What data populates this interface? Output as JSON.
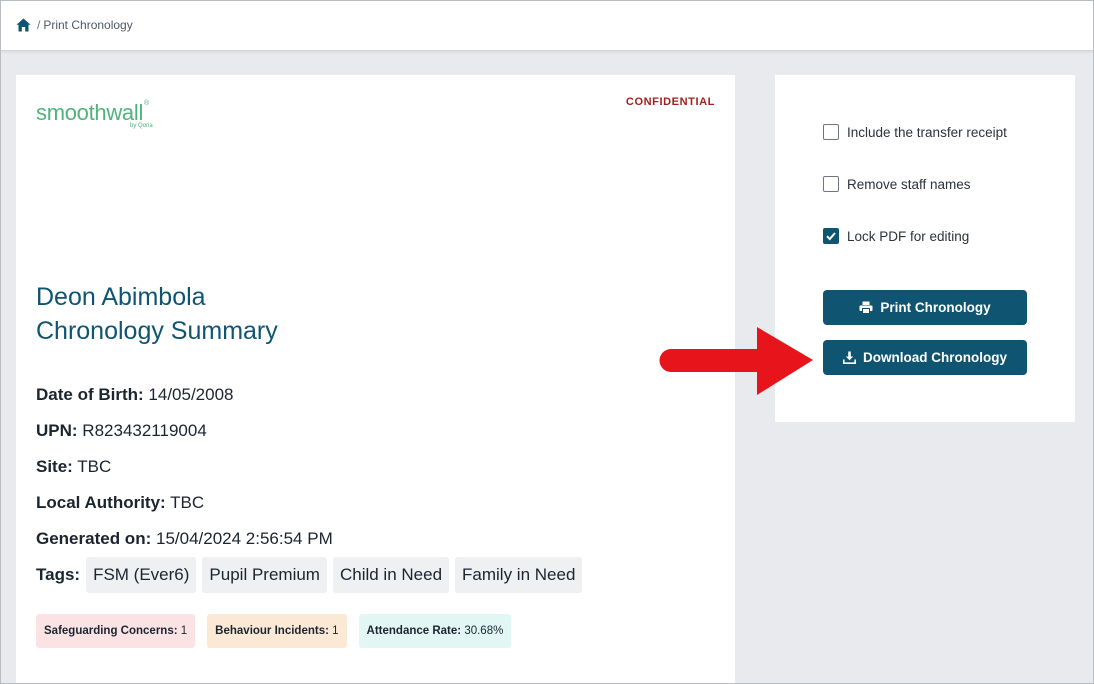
{
  "breadcrumb": {
    "home_icon": "home-icon",
    "separator": "/",
    "current": "Print Chronology"
  },
  "document": {
    "logo": {
      "text": "smoothwall",
      "sub": "by Qoria"
    },
    "confidential": "CONFIDENTIAL",
    "title_line1": "Deon Abimbola",
    "title_line2": "Chronology Summary",
    "fields": [
      {
        "label": "Date of Birth:",
        "value": "14/05/2008"
      },
      {
        "label": "UPN:",
        "value": "R823432119004"
      },
      {
        "label": "Site:",
        "value": "TBC"
      },
      {
        "label": "Local Authority:",
        "value": "TBC"
      },
      {
        "label": "Generated on:",
        "value": "15/04/2024 2:56:54 PM"
      }
    ],
    "tags_label": "Tags:",
    "tags": [
      "FSM (Ever6)",
      "Pupil Premium",
      "Child in Need",
      "Family in Need"
    ],
    "stats": [
      {
        "label": "Safeguarding Concerns:",
        "value": "1",
        "color": "#fbe3e4"
      },
      {
        "label": "Behaviour Incidents:",
        "value": "1",
        "color": "#fbe9d6"
      },
      {
        "label": "Attendance Rate:",
        "value": "30.68%",
        "color": "#e2f6f4"
      }
    ]
  },
  "options": {
    "items": [
      {
        "label": "Include the transfer receipt",
        "checked": false
      },
      {
        "label": "Remove staff names",
        "checked": false
      },
      {
        "label": "Lock PDF for editing",
        "checked": true
      }
    ],
    "print_button": "Print Chronology",
    "download_button": "Download Chronology"
  },
  "colors": {
    "accent": "#0f5572",
    "confidential": "#a3201d",
    "logo": "#4fb37b",
    "annotation_arrow": "#e8141b"
  }
}
